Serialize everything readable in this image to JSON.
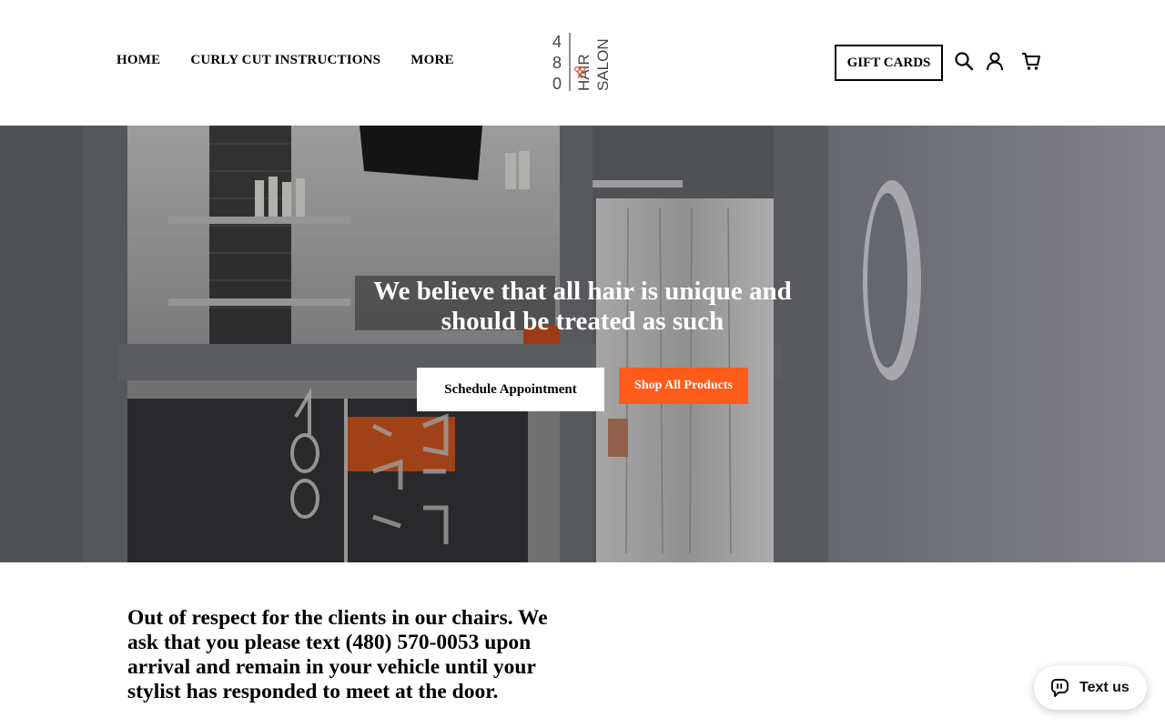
{
  "header": {
    "nav": [
      "HOME",
      "CURLY CUT INSTRUCTIONS",
      "MORE"
    ],
    "logo": {
      "digits": [
        "4",
        "8",
        "0"
      ],
      "word1": "HAIR",
      "word2": "SALON",
      "accent_color": "#e8542b"
    },
    "gift_cards_label": "GIFT CARDS",
    "icons": [
      "search-icon",
      "account-icon",
      "cart-icon"
    ]
  },
  "hero": {
    "title": "We believe that all hair is unique and should be treated as such",
    "schedule_label": "Schedule Appointment",
    "shop_label": "Shop All Products"
  },
  "notice": {
    "text": "Out of respect for the clients in our chairs. We ask that you please text (480) 570-0053 upon arrival and remain in your vehicle until your stylist has responded to meet at the door."
  },
  "widget": {
    "label": "Text us"
  },
  "colors": {
    "accent": "#ff5b1a",
    "text": "#000000",
    "background": "#ffffff"
  }
}
